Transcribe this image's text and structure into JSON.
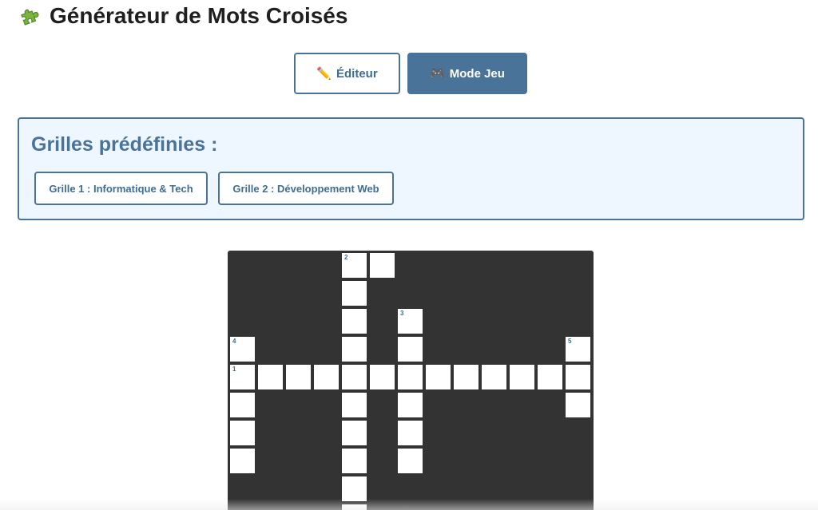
{
  "page": {
    "title": "Générateur de Mots Croisés",
    "title_icon": "puzzle-piece-icon"
  },
  "modes": {
    "editor_label": "Éditeur",
    "editor_icon": "pencil-icon",
    "play_label": "Mode Jeu",
    "play_icon": "gamepad-icon"
  },
  "presets": {
    "heading": "Grilles prédéfinies :",
    "items": [
      {
        "label": "Grille 1 : Informatique & Tech"
      },
      {
        "label": "Grille 2 : Développement Web"
      }
    ]
  },
  "grid": {
    "rows": 10,
    "cols": 13,
    "cells": [
      {
        "row": 0,
        "col": 4,
        "number": "2"
      },
      {
        "row": 0,
        "col": 5
      },
      {
        "row": 1,
        "col": 4
      },
      {
        "row": 2,
        "col": 4
      },
      {
        "row": 2,
        "col": 6,
        "number": "3"
      },
      {
        "row": 3,
        "col": 0,
        "number": "4"
      },
      {
        "row": 3,
        "col": 4
      },
      {
        "row": 3,
        "col": 6
      },
      {
        "row": 3,
        "col": 12,
        "number": "5"
      },
      {
        "row": 4,
        "col": 0,
        "number": "1"
      },
      {
        "row": 4,
        "col": 1
      },
      {
        "row": 4,
        "col": 2
      },
      {
        "row": 4,
        "col": 3
      },
      {
        "row": 4,
        "col": 4
      },
      {
        "row": 4,
        "col": 5
      },
      {
        "row": 4,
        "col": 6
      },
      {
        "row": 4,
        "col": 7
      },
      {
        "row": 4,
        "col": 8
      },
      {
        "row": 4,
        "col": 9
      },
      {
        "row": 4,
        "col": 10
      },
      {
        "row": 4,
        "col": 11
      },
      {
        "row": 4,
        "col": 12
      },
      {
        "row": 5,
        "col": 0
      },
      {
        "row": 5,
        "col": 4
      },
      {
        "row": 5,
        "col": 6
      },
      {
        "row": 5,
        "col": 12
      },
      {
        "row": 6,
        "col": 0
      },
      {
        "row": 6,
        "col": 4
      },
      {
        "row": 6,
        "col": 6
      },
      {
        "row": 7,
        "col": 0
      },
      {
        "row": 7,
        "col": 4
      },
      {
        "row": 7,
        "col": 6
      },
      {
        "row": 8,
        "col": 4
      },
      {
        "row": 9,
        "col": 4
      }
    ]
  },
  "colors": {
    "accent": "#4a7399",
    "panel_background": "#eef7ff",
    "grid_background": "#333333",
    "cell_background": "#ffffff"
  }
}
